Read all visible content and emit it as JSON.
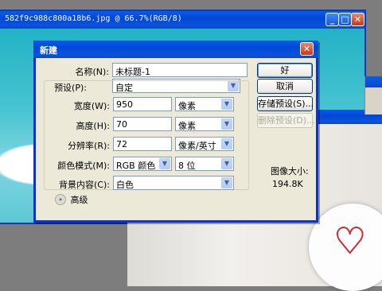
{
  "doc_window": {
    "title": "582f9c988c800a18b6.jpg @ 66.7%(RGB/8)"
  },
  "dialog": {
    "title": "新建",
    "name_label": "名称(N):",
    "name_value": "未标题-1",
    "preset_label": "预设(P):",
    "preset_value": "自定",
    "width_label": "宽度(W):",
    "width_value": "950",
    "width_unit": "像素",
    "height_label": "高度(H):",
    "height_value": "70",
    "height_unit": "像素",
    "resolution_label": "分辨率(R):",
    "resolution_value": "72",
    "resolution_unit": "像素/英寸",
    "color_mode_label": "颜色模式(M):",
    "color_mode_value": "RGB 颜色",
    "bit_depth_value": "8 位",
    "background_label": "背景内容(C):",
    "background_value": "白色",
    "advanced_label": "高级",
    "ok_label": "好",
    "cancel_label": "取消",
    "save_preset_label": "存储预设(S)...",
    "delete_preset_label": "删除预设(D)...",
    "image_size_label": "图像大小:",
    "image_size_value": "194.8K"
  }
}
